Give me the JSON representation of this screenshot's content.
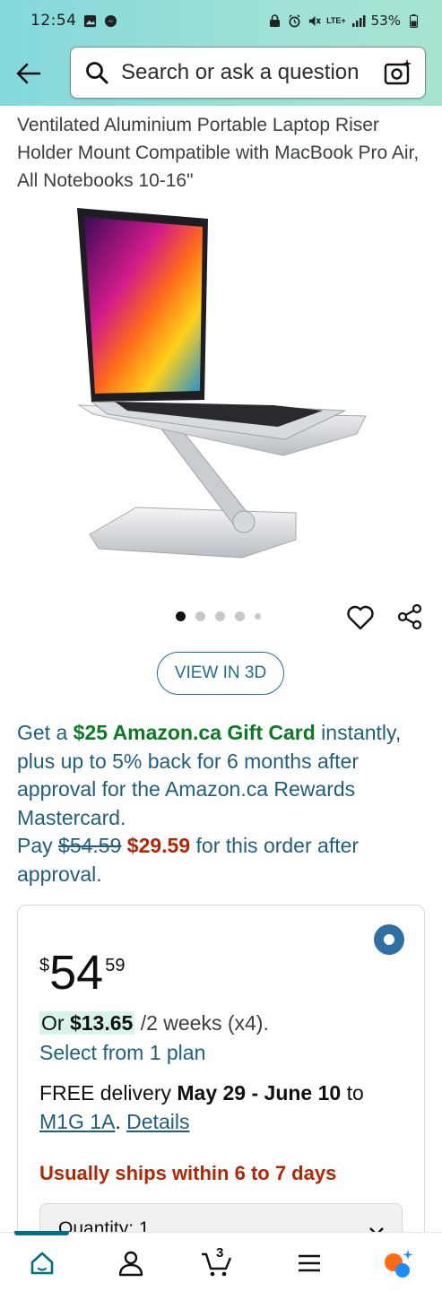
{
  "status_bar": {
    "time": "12:54",
    "network": "LTE+",
    "battery": "53%"
  },
  "search": {
    "placeholder": "Search or ask a question"
  },
  "product": {
    "title": "Ventilated Aluminium Portable Laptop Riser Holder Mount Compatible with MacBook Pro Air, All Notebooks 10-16\"",
    "image_icon": "laptop-stand-image",
    "carousel": {
      "total": 5,
      "active": 1
    }
  },
  "view3d_label": "VIEW IN 3D",
  "promo": {
    "part1": "Get a ",
    "gift": "$25 Amazon.ca Gift Card",
    "part2": " instantly, plus up to 5% back for 6 months after approval for the Amazon.ca Rewards Mastercard.",
    "part3": "Pay ",
    "old_price": "$54.59",
    "new_price": "$29.59",
    "part4": " for this order after approval."
  },
  "buy_box": {
    "price_symbol": "$",
    "price_whole": "54",
    "price_fraction": "59",
    "installment_prefix": "Or ",
    "installment_amount": "$13.65",
    "installment_suffix": " /2 weeks (x4).",
    "select_plan": "Select from 1 plan",
    "delivery_prefix": "FREE delivery ",
    "delivery_dates": "May 29 - June 10",
    "delivery_to": " to",
    "postal_code": "M1G 1A",
    "delivery_sep": ". ",
    "details_link": "Details",
    "ships_text": "Usually ships within 6 to 7 days",
    "quantity_label": "Quantity: 1"
  },
  "bottom_nav": {
    "cart_count": "3"
  },
  "colors": {
    "header_teal": "#9ee1d6",
    "link_blue": "#1f5f7d",
    "price_red": "#b12704",
    "gift_green": "#0b7a23",
    "nav_active": "#007185"
  }
}
